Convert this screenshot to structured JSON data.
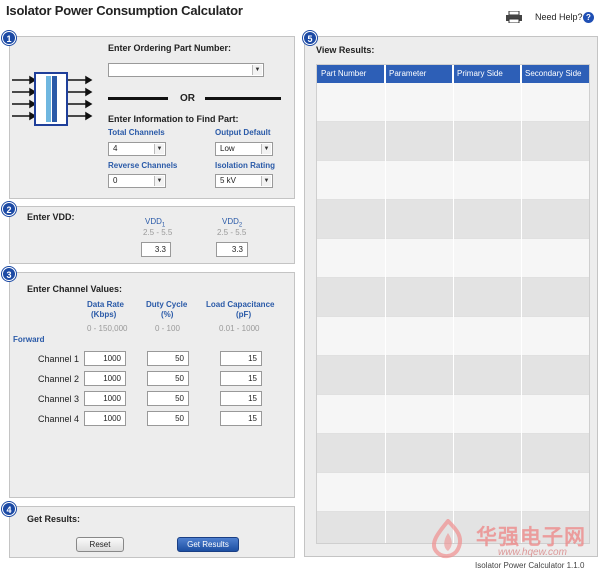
{
  "header": {
    "title": "Isolator Power Consumption Calculator",
    "help_label": "Need Help?",
    "help_icon": "?"
  },
  "section1": {
    "step": "1",
    "part_number_label": "Enter Ordering Part Number:",
    "part_number_value": "",
    "or_label": "OR",
    "find_part_label": "Enter Information to Find Part:",
    "total_channels_label": "Total Channels",
    "total_channels_value": "4",
    "output_default_label": "Output Default",
    "output_default_value": "Low",
    "reverse_channels_label": "Reverse Channels",
    "reverse_channels_value": "0",
    "isolation_rating_label": "Isolation Rating",
    "isolation_rating_value": "5 kV"
  },
  "section2": {
    "step": "2",
    "title": "Enter VDD:",
    "vdd1_label": "VDD",
    "vdd1_sub": "1",
    "vdd1_range": "2.5 - 5.5",
    "vdd1_value": "3.3",
    "vdd2_label": "VDD",
    "vdd2_sub": "2",
    "vdd2_range": "2.5 - 5.5",
    "vdd2_value": "3.3"
  },
  "section3": {
    "step": "3",
    "title": "Enter Channel Values:",
    "data_rate_label": "Data Rate",
    "data_rate_unit": "(Kbps)",
    "data_rate_range": "0 - 150,000",
    "duty_cycle_label": "Duty Cycle",
    "duty_cycle_unit": "(%)",
    "duty_cycle_range": "0 - 100",
    "load_cap_label": "Load Capacitance",
    "load_cap_unit": "(pF)",
    "load_cap_range": "0.01 - 1000",
    "direction_label": "Forward",
    "channels": [
      {
        "name": "Channel 1",
        "data_rate": "1000",
        "duty_cycle": "50",
        "load_cap": "15"
      },
      {
        "name": "Channel 2",
        "data_rate": "1000",
        "duty_cycle": "50",
        "load_cap": "15"
      },
      {
        "name": "Channel 3",
        "data_rate": "1000",
        "duty_cycle": "50",
        "load_cap": "15"
      },
      {
        "name": "Channel 4",
        "data_rate": "1000",
        "duty_cycle": "50",
        "load_cap": "15"
      }
    ]
  },
  "section4": {
    "step": "4",
    "title": "Get Results:",
    "reset_label": "Reset",
    "get_results_label": "Get Results"
  },
  "section5": {
    "step": "5",
    "title": "View Results:",
    "columns": [
      "Part Number",
      "Parameter",
      "Primary Side",
      "Secondary Side"
    ]
  },
  "footer": {
    "version": "Isolator Power Calculator 1.1.0",
    "watermark": "华强电子网",
    "watermark_url": "www.hqew.com"
  },
  "colors": {
    "accent": "#2d5fb7",
    "step_badge": "#1c4aa5",
    "panel": "#ededed",
    "label_blue": "#2a5aa8"
  },
  "icons": {
    "print": "printer-icon",
    "help": "help-icon",
    "isolator": "isolator-diagram-icon",
    "dropdown": "chevron-down-icon"
  }
}
